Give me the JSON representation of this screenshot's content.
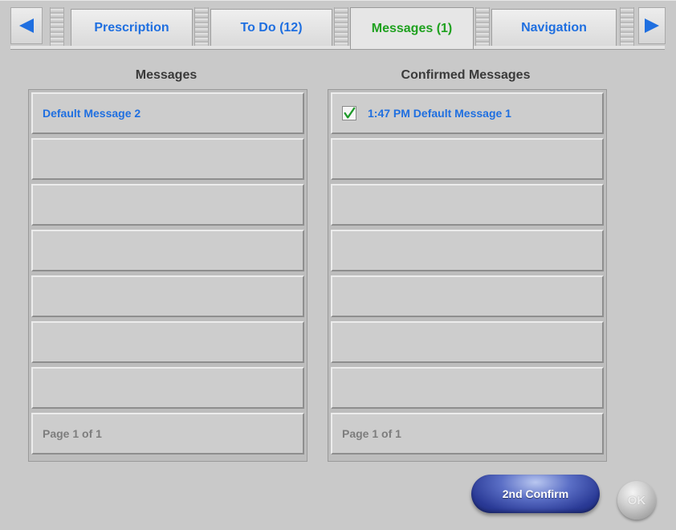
{
  "tabs": [
    {
      "label": "Prescription",
      "active": false
    },
    {
      "label": "To Do (12)",
      "active": false
    },
    {
      "label": "Messages (1)",
      "active": true
    },
    {
      "label": "Navigation",
      "active": false
    }
  ],
  "nav": {
    "prev_icon": "triangle-left-icon",
    "next_icon": "triangle-right-icon"
  },
  "messages": {
    "title": "Messages",
    "items": [
      "Default Message 2",
      "",
      "",
      "",
      "",
      "",
      ""
    ],
    "pager": "Page 1 of 1"
  },
  "confirmed": {
    "title": "Confirmed Messages",
    "items": [
      {
        "label": "1:47 PM Default Message 1",
        "checked": true
      },
      {
        "label": ""
      },
      {
        "label": ""
      },
      {
        "label": ""
      },
      {
        "label": ""
      },
      {
        "label": ""
      },
      {
        "label": ""
      }
    ],
    "pager": "Page 1 of 1"
  },
  "buttons": {
    "confirm": "2nd Confirm",
    "ok": "OK"
  },
  "colors": {
    "tab_text": "#1f6fe0",
    "active_tab_text": "#1fa11f",
    "row_text": "#1f6fe0",
    "confirm_button": "#2a3a96"
  }
}
